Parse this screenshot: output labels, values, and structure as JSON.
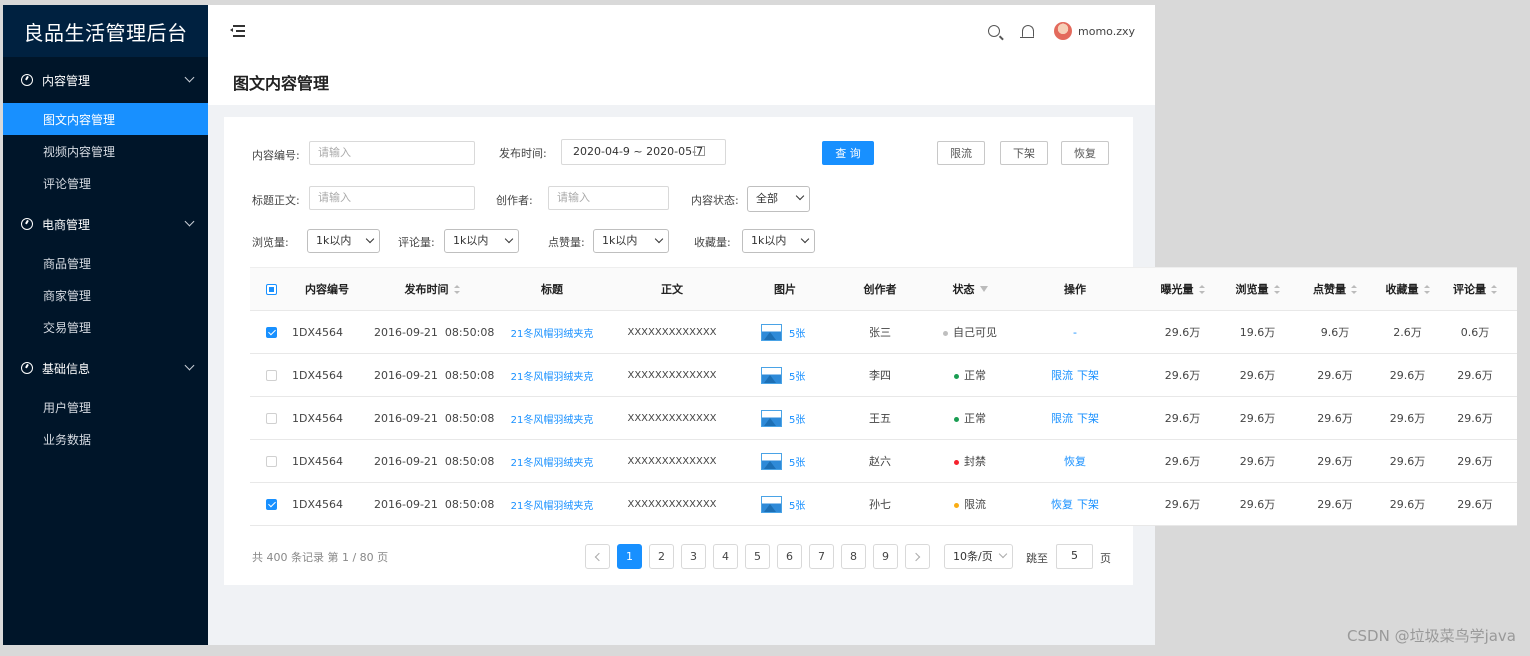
{
  "app": {
    "title": "良品生活管理后台"
  },
  "sidebar": {
    "groups": [
      {
        "label": "内容管理",
        "items": [
          {
            "label": "图文内容管理",
            "active": true
          },
          {
            "label": "视频内容管理"
          },
          {
            "label": "评论管理"
          }
        ]
      },
      {
        "label": "电商管理",
        "items": [
          {
            "label": "商品管理"
          },
          {
            "label": "商家管理"
          },
          {
            "label": "交易管理"
          }
        ]
      },
      {
        "label": "基础信息",
        "items": [
          {
            "label": "用户管理"
          },
          {
            "label": "业务数据"
          }
        ]
      }
    ]
  },
  "header": {
    "user_name": "momo.zxy",
    "icons": [
      "menu-fold-icon",
      "search-icon",
      "bell-icon",
      "avatar"
    ]
  },
  "page": {
    "title": "图文内容管理"
  },
  "filters": {
    "content_id": {
      "label": "内容编号:",
      "placeholder": "请输入"
    },
    "publish_time": {
      "label": "发布时间:",
      "value": "2020-04-9 ~ 2020-05-7"
    },
    "query_label": "查 询",
    "limit_label": "限流",
    "offline_label": "下架",
    "restore_label": "恢复",
    "title_text": {
      "label": "标题正文:",
      "placeholder": "请输入"
    },
    "creator": {
      "label": "创作者:",
      "placeholder": "请输入"
    },
    "status": {
      "label": "内容状态:",
      "value": "全部"
    },
    "views": {
      "label": "浏览量:",
      "value": "1k以内"
    },
    "comments": {
      "label": "评论量:",
      "value": "1k以内"
    },
    "likes": {
      "label": "点赞量:",
      "value": "1k以内"
    },
    "favorites": {
      "label": "收藏量:",
      "value": "1k以内"
    }
  },
  "table": {
    "columns": [
      "内容编号",
      "发布时间",
      "标题",
      "正文",
      "图片",
      "创作者",
      "状态",
      "操作",
      "曝光量",
      "浏览量",
      "点赞量",
      "收藏量",
      "评论量"
    ],
    "rows": [
      {
        "checked": true,
        "id": "1DX4564",
        "time": "2016-09-21  08:50:08",
        "title": "21冬风帽羽绒夹克",
        "body": "XXXXXXXXXXXXX",
        "images": "5张",
        "creator": "张三",
        "status": "自己可见",
        "status_color": "#bfbfbf",
        "ops": [
          "-"
        ],
        "exposure": "29.6万",
        "views": "19.6万",
        "likes": "9.6万",
        "favorites": "2.6万",
        "comments": "0.6万"
      },
      {
        "checked": false,
        "id": "1DX4564",
        "time": "2016-09-21  08:50:08",
        "title": "21冬风帽羽绒夹克",
        "body": "XXXXXXXXXXXXX",
        "images": "5张",
        "creator": "李四",
        "status": "正常",
        "status_color": "#1a9d52",
        "ops": [
          "限流",
          "下架"
        ],
        "exposure": "29.6万",
        "views": "29.6万",
        "likes": "29.6万",
        "favorites": "29.6万",
        "comments": "29.6万"
      },
      {
        "checked": false,
        "id": "1DX4564",
        "time": "2016-09-21  08:50:08",
        "title": "21冬风帽羽绒夹克",
        "body": "XXXXXXXXXXXXX",
        "images": "5张",
        "creator": "王五",
        "status": "正常",
        "status_color": "#1a9d52",
        "ops": [
          "限流",
          "下架"
        ],
        "exposure": "29.6万",
        "views": "29.6万",
        "likes": "29.6万",
        "favorites": "29.6万",
        "comments": "29.6万"
      },
      {
        "checked": false,
        "id": "1DX4564",
        "time": "2016-09-21  08:50:08",
        "title": "21冬风帽羽绒夹克",
        "body": "XXXXXXXXXXXXX",
        "images": "5张",
        "creator": "赵六",
        "status": "封禁",
        "status_color": "#f5222d",
        "ops": [
          "恢复"
        ],
        "exposure": "29.6万",
        "views": "29.6万",
        "likes": "29.6万",
        "favorites": "29.6万",
        "comments": "29.6万"
      },
      {
        "checked": true,
        "id": "1DX4564",
        "time": "2016-09-21  08:50:08",
        "title": "21冬风帽羽绒夹克",
        "body": "XXXXXXXXXXXXX",
        "images": "5张",
        "creator": "孙七",
        "status": "限流",
        "status_color": "#faad14",
        "ops": [
          "恢复",
          "下架"
        ],
        "exposure": "29.6万",
        "views": "29.6万",
        "likes": "29.6万",
        "favorites": "29.6万",
        "comments": "29.6万"
      }
    ]
  },
  "pagination": {
    "summary": "共 400 条记录 第 1 / 80 页",
    "pages": [
      "1",
      "2",
      "3",
      "4",
      "5",
      "6",
      "7",
      "8",
      "9"
    ],
    "current": "1",
    "page_size": "10条/页",
    "jump_label": "跳至",
    "jump_value": "5",
    "page_suffix": "页"
  },
  "watermark": "CSDN @垃圾菜鸟学java"
}
